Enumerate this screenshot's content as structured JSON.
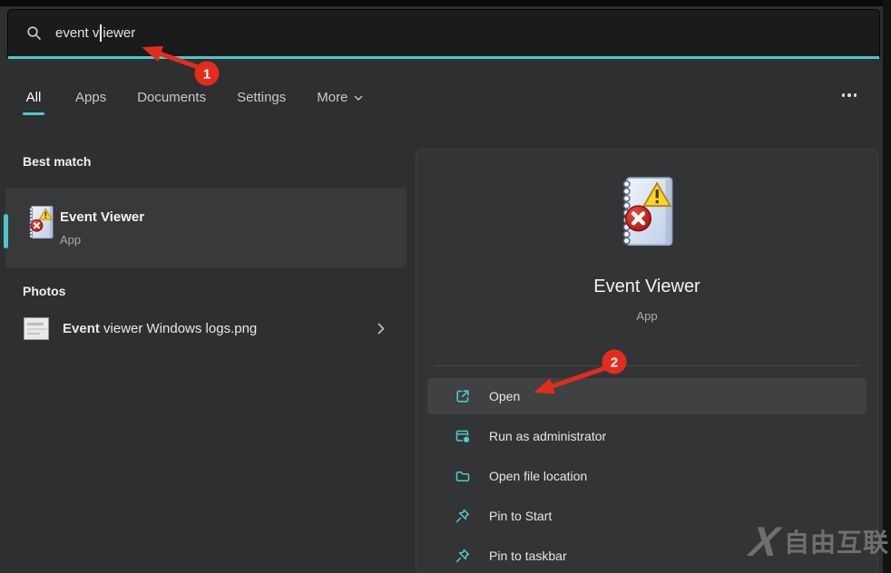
{
  "colors": {
    "accent": "#4fc8c8",
    "annotation_red": "#e22d1d"
  },
  "search": {
    "full_value": "event viewer",
    "text_before_cursor": "event v",
    "text_after_cursor": "iewer"
  },
  "tabs": [
    {
      "label": "All",
      "active": true
    },
    {
      "label": "Apps",
      "active": false
    },
    {
      "label": "Documents",
      "active": false
    },
    {
      "label": "Settings",
      "active": false
    },
    {
      "label": "More",
      "active": false
    }
  ],
  "best_match": {
    "heading": "Best match",
    "title": "Event Viewer",
    "subtitle": "App"
  },
  "photos": {
    "heading": "Photos",
    "match": "Event",
    "rest": " viewer Windows logs.png"
  },
  "preview": {
    "title": "Event Viewer",
    "subtitle": "App",
    "actions": [
      {
        "label": "Open",
        "icon": "open-external-icon",
        "highlighted": true
      },
      {
        "label": "Run as administrator",
        "icon": "admin-shield-icon",
        "highlighted": false
      },
      {
        "label": "Open file location",
        "icon": "folder-icon",
        "highlighted": false
      },
      {
        "label": "Pin to Start",
        "icon": "pin-icon",
        "highlighted": false
      },
      {
        "label": "Pin to taskbar",
        "icon": "pin-icon",
        "highlighted": false
      }
    ]
  },
  "annotations": {
    "step1": "1",
    "step2": "2"
  },
  "watermark": {
    "logo": "X",
    "text": "自由互联"
  }
}
